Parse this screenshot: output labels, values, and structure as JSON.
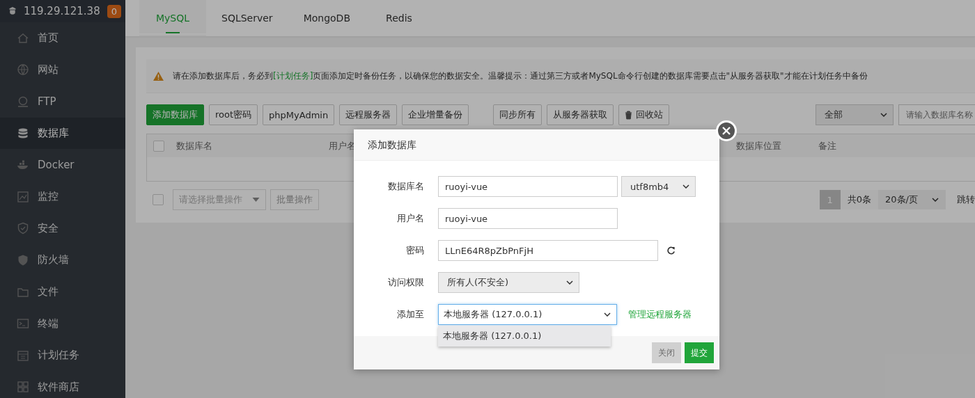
{
  "server": {
    "ip": "119.29.121.38",
    "badge": "0"
  },
  "sidebar": {
    "items": [
      {
        "label": "首页",
        "selected": false
      },
      {
        "label": "网站",
        "selected": false
      },
      {
        "label": "FTP",
        "selected": false
      },
      {
        "label": "数据库",
        "selected": true
      },
      {
        "label": "Docker",
        "selected": false
      },
      {
        "label": "监控",
        "selected": false
      },
      {
        "label": "安全",
        "selected": false
      },
      {
        "label": "防火墙",
        "selected": false
      },
      {
        "label": "文件",
        "selected": false
      },
      {
        "label": "终端",
        "selected": false
      },
      {
        "label": "计划任务",
        "selected": false
      },
      {
        "label": "软件商店",
        "selected": false
      }
    ]
  },
  "tabs": [
    {
      "label": "MySQL",
      "selected": true
    },
    {
      "label": "SQLServer",
      "selected": false
    },
    {
      "label": "MongoDB",
      "selected": false
    },
    {
      "label": "Redis",
      "selected": false
    }
  ],
  "notice": {
    "before": "请在添加数据库后，务必到",
    "link": "[计划任务]",
    "after": "页面添加定时备份任务，以确保您的数据安全。温馨提示：通过第三方或者MySQL命令行创建的数据库需要点击\"从服务器获取\"才能在计划任务中备份"
  },
  "toolbar": {
    "buttons": [
      {
        "label": "添加数据库",
        "kind": "primary"
      },
      {
        "label": "root密码",
        "kind": "plain"
      },
      {
        "label": "phpMyAdmin",
        "kind": "plain"
      },
      {
        "label": "远程服务器",
        "kind": "plain"
      },
      {
        "label": "企业增量备份",
        "kind": "plain"
      },
      {
        "label": "同步所有",
        "kind": "spaced"
      },
      {
        "label": "从服务器获取",
        "kind": "plain"
      },
      {
        "label": "回收站",
        "kind": "trash"
      }
    ],
    "filter": "全部",
    "search_placeholder": "请输入数据库名称"
  },
  "table": {
    "select_all_checked": false,
    "columns": [
      "数据库名",
      "用户名",
      "数据库位置",
      "备注"
    ]
  },
  "batch": {
    "checked": false,
    "placeholder": "请选择批量操作",
    "button": "批量操作"
  },
  "pagination": {
    "pages": [
      {
        "label": "1",
        "selected": true
      }
    ],
    "total": "共0条",
    "page_size": "20条/页",
    "jump": "跳转"
  },
  "dialog": {
    "title": "添加数据库",
    "fields": [
      {
        "label": "数据库名",
        "kind": "input",
        "value": "ruoyi-vue",
        "extra": "utf8mb4"
      },
      {
        "label": "用户名",
        "kind": "input",
        "value": "ruoyi-vue"
      },
      {
        "label": "密码",
        "kind": "password",
        "value": "LLnE64R8pZbPnFjH"
      },
      {
        "label": "访问权限",
        "kind": "select",
        "value": "所有人(不安全)"
      },
      {
        "label": "添加至",
        "kind": "open-select",
        "value": "本地服务器 (127.0.0.1)",
        "link": "管理远程服务器",
        "options": [
          "本地服务器 (127.0.0.1)"
        ]
      }
    ],
    "buttons": [
      {
        "label": "关闭",
        "disabled": true
      },
      {
        "label": "提交",
        "disabled": false
      }
    ]
  }
}
